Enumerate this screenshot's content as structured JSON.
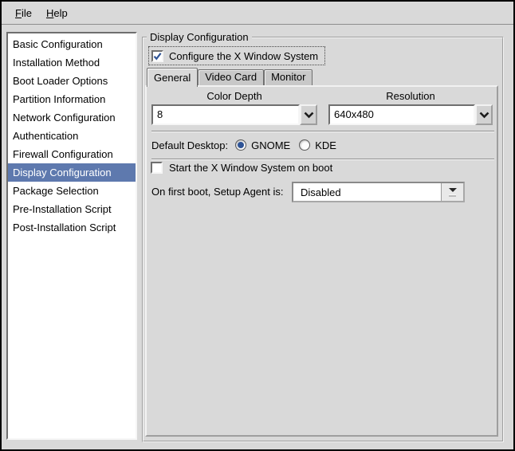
{
  "menubar": {
    "items": [
      {
        "mnemonic": "F",
        "rest": "ile",
        "label": "File"
      },
      {
        "mnemonic": "H",
        "rest": "elp",
        "label": "Help"
      }
    ]
  },
  "sidebar": {
    "items": [
      "Basic Configuration",
      "Installation Method",
      "Boot Loader Options",
      "Partition Information",
      "Network Configuration",
      "Authentication",
      "Firewall Configuration",
      "Display Configuration",
      "Package Selection",
      "Pre-Installation Script",
      "Post-Installation Script"
    ],
    "selected_index": 7
  },
  "panel": {
    "frame_title": "Display Configuration",
    "configure_x": {
      "label": "Configure the X Window System",
      "checked": true
    },
    "tabs": [
      {
        "label": "General"
      },
      {
        "label": "Video Card"
      },
      {
        "label": "Monitor"
      }
    ],
    "active_tab_index": 0,
    "general": {
      "color_depth_label": "Color Depth",
      "color_depth_value": "8",
      "resolution_label": "Resolution",
      "resolution_value": "640x480",
      "default_desktop_label": "Default Desktop:",
      "desktop_options": [
        {
          "label": "GNOME",
          "selected": true
        },
        {
          "label": "KDE",
          "selected": false
        }
      ],
      "start_x_label": "Start the X Window System on boot",
      "start_x_checked": false,
      "setup_agent_label": "On first boot, Setup Agent is:",
      "setup_agent_value": "Disabled"
    }
  },
  "icons": {
    "checkbox_check": "✓",
    "combo_chevron": "⌄",
    "option_menu_indicator": "▾"
  },
  "colors": {
    "background": "#d9d9d9",
    "selection": "#5e79ae",
    "selection_text": "#ffffff",
    "accent_blue": "#2f5496",
    "inactive_tab": "#c8c8c8",
    "entry_background": "#ffffff"
  }
}
